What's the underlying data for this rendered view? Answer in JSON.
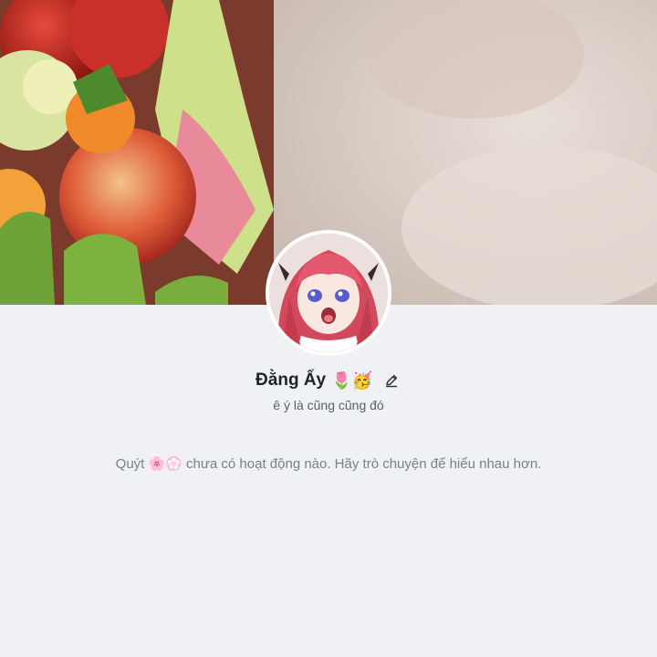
{
  "profile": {
    "display_name": "Đằng Ấy",
    "name_emoji": "🌷🥳",
    "bio": "ê ý là cũng cũng đó",
    "edit_icon": "pencil-icon",
    "cover_image": "fruit-basket-photo",
    "avatar_image": "anime-girl-avatar"
  },
  "activity": {
    "empty_message": "Quýt 🌸💮 chưa có hoạt động nào. Hãy trò chuyện để hiểu nhau hơn."
  }
}
